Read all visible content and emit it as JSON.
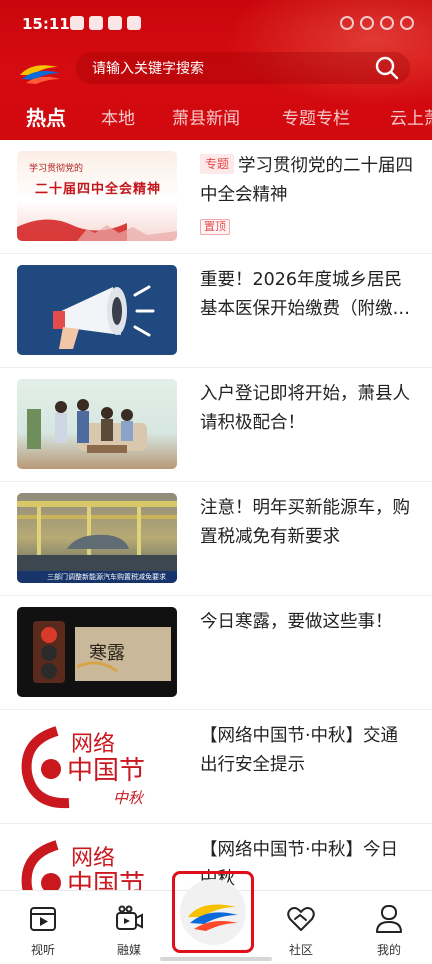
{
  "status_bar": {
    "time": "15:11"
  },
  "search": {
    "placeholder": "请输入关键字搜索"
  },
  "tabs": [
    "热点",
    "本地",
    "萧县新闻",
    "专题专栏",
    "云上萧"
  ],
  "articles": [
    {
      "tag": "专题",
      "title": "学习贯彻党的二十届四中全会精神",
      "badge": "置顶",
      "thumb_small": "学习贯彻党的",
      "thumb_big": "二十届四中全会精神"
    },
    {
      "title": "重要！2026年度城乡居民基本医保开始缴费（附缴…"
    },
    {
      "title": "入户登记即将开始，萧县人请积极配合！"
    },
    {
      "title": "注意！明年买新能源车，购置税减免有新要求",
      "thumb_caption": "三部门调整新能源汽车购置税减免要求"
    },
    {
      "title": "今日寒露，要做这些事！",
      "thumb_text": "寒露"
    },
    {
      "title": "【网络中国节·中秋】交通出行安全提示",
      "thumb_text_1": "网络",
      "thumb_text_2": "中国节",
      "thumb_text_3": "中秋"
    },
    {
      "title": "【网络中国节·中秋】今日中秋",
      "thumb_text_1": "网络",
      "thumb_text_2": "中国节"
    }
  ],
  "nav": [
    "视听",
    "融媒",
    "社区",
    "我的"
  ],
  "colors": {
    "brand_red": "#d10a0f",
    "tag_red": "#e74a4a"
  }
}
